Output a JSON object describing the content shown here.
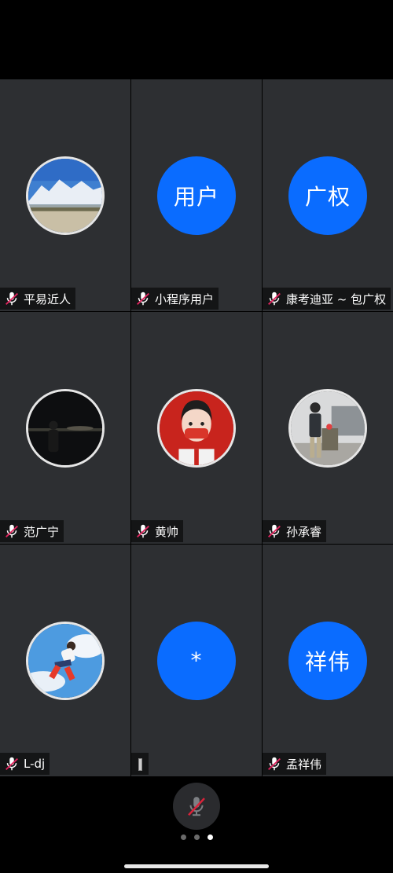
{
  "colors": {
    "accent": "#0a6cff",
    "tile_bg": "#2d2f32",
    "muted_mic": "#e0245e"
  },
  "participants": [
    {
      "name": "平易近人",
      "avatar": "photo-mountain"
    },
    {
      "name": "小程序用户",
      "avatar_text": "用户"
    },
    {
      "name": "康考迪亚 ~ 包广权",
      "avatar_text": "广权"
    },
    {
      "name": "范广宁",
      "avatar": "photo-night"
    },
    {
      "name": "黄帅",
      "avatar": "photo-cartoon"
    },
    {
      "name": "孙承睿",
      "avatar": "photo-street"
    },
    {
      "name": "L-dj",
      "avatar": "photo-jump"
    },
    {
      "name": "",
      "avatar_text": "*"
    },
    {
      "name": "孟祥伟",
      "avatar_text": "祥伟"
    }
  ],
  "pager": {
    "pages": 3,
    "current": 3
  },
  "controls": {
    "mute_icon": "mic-muted-icon"
  }
}
